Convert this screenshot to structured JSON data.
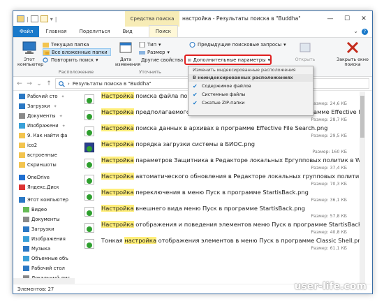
{
  "window": {
    "context_tab": "Средства поиска",
    "title": "настройка - Результаты поиска в \"Buddha\"",
    "controls": [
      "—",
      "☐",
      "✕"
    ]
  },
  "ribbon_tabs": [
    "Файл",
    "Главная",
    "Поделиться",
    "Вид",
    "Поиск"
  ],
  "ribbon": {
    "this_pc": "Этот компьютер",
    "current_folder": "Текущая папка",
    "all_subfolders": "Все вложенные папки",
    "search_again": "Повторить поиск",
    "location_group": "Расположение",
    "date_modified": "Дата изменения",
    "type": "Тип",
    "size": "Размер",
    "other_props": "Другие свойства",
    "refine_group": "Уточнить",
    "recent_searches": "Предыдущие поисковые запросы",
    "advanced_options": "Дополнительные параметры",
    "change_indexed": "Изменить индексированные расположения",
    "open_location_label": "Открыть",
    "file_location": "файла",
    "close_search": "Закрыть окно поиска"
  },
  "dropdown": {
    "heading_indexed": "Изменить индексированные расположения",
    "heading_nonindexed": "В неиндексированных расположениях",
    "items": [
      "Содержимое файлов",
      "Системные файлы",
      "Сжатые ZIP-папки"
    ]
  },
  "address": {
    "path": "Результаты поиска в \"Buddha\""
  },
  "nav_pane": [
    {
      "label": "Рабочий сто",
      "pinned": true
    },
    {
      "label": "Загрузки",
      "pinned": true
    },
    {
      "label": "Документы",
      "pinned": true
    },
    {
      "label": "Изображени",
      "pinned": true
    },
    {
      "label": "9. Как найти фа",
      "pinned": false
    },
    {
      "label": "ico2",
      "pinned": false
    },
    {
      "label": "встроенные",
      "pinned": false
    },
    {
      "label": "Скриншоты",
      "pinned": false
    },
    {
      "label": "OneDrive",
      "pinned": false
    },
    {
      "label": "Яндекс.Диск",
      "pinned": false
    },
    {
      "label": "Этот компьютер",
      "pinned": false
    },
    {
      "label": "Видео",
      "pinned": false
    },
    {
      "label": "Документы",
      "pinned": false
    },
    {
      "label": "Загрузки",
      "pinned": false
    },
    {
      "label": "Изображения",
      "pinned": false
    },
    {
      "label": "Музыка",
      "pinned": false
    },
    {
      "label": "Объемные объ",
      "pinned": false
    },
    {
      "label": "Рабочий стол",
      "pinned": false
    },
    {
      "label": "Локальный дис",
      "pinned": false
    }
  ],
  "files": [
    {
      "pre": "",
      "hit": "Настройка",
      "post": " поиска файла по со...",
      "size": "Размер: 24,6 КБ",
      "suffix": "rch.png"
    },
    {
      "pre": "",
      "hit": "Настройка",
      "post": " предполагаемого диапазона дат создания файла в программе Effective File ...",
      "size": "Размер: 28,7 КБ"
    },
    {
      "pre": "",
      "hit": "Настройка",
      "post": " поиска данных в архивах в программе Effective File Search.png",
      "size": "Размер: 29,5 КБ"
    },
    {
      "pre": "",
      "hit": "Настройка",
      "post": " порядка загрузки системы в БИОС.png",
      "size": "Размер: 160 КБ"
    },
    {
      "pre": "",
      "hit": "Настройка",
      "post": " параметров Защитника в Редакторе локальных Ергупповых политик в Windo...",
      "size": "Размер: 37,4 КБ"
    },
    {
      "pre": "",
      "hit": "Настройка",
      "post": " автоматического обновления в Редакторе локальных групповых политик в ...",
      "size": "Размер: 70,3 КБ"
    },
    {
      "pre": "",
      "hit": "Настройка",
      "post": " переключения в меню Пуск в программе StartisBack.png",
      "size": "Размер: 36,1 КБ"
    },
    {
      "pre": "",
      "hit": "Настройка",
      "post": " внешнего вида меню Пуск в программе StartisBack.png",
      "size": "Размер: 57,8 КБ"
    },
    {
      "pre": "",
      "hit": "Настройка",
      "post": " отображения и поведения элементов меню Пуск в программе StartisBack.png",
      "size": "Размер: 40,8 КБ"
    },
    {
      "pre": "Тонкая ",
      "hit": "настройка",
      "post": " отображения элементов в меню Пуск в программе Classic Shell.png",
      "size": "Размер: 61,1 КБ"
    }
  ],
  "status": {
    "items_count": "Элементов: 27"
  },
  "watermark": "user-life.com"
}
